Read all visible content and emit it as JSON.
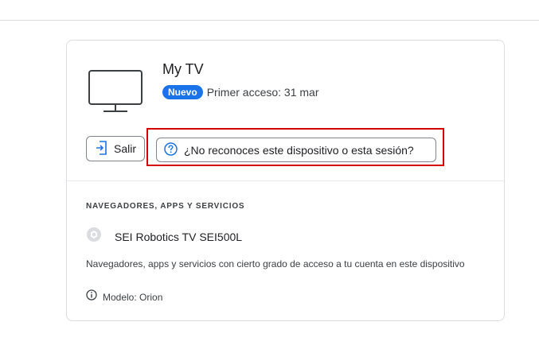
{
  "device": {
    "name": "My TV",
    "badge": "Nuevo",
    "first_access": "Primer acceso: 31 mar"
  },
  "actions": {
    "signout_label": "Salir",
    "unrecognized_label": "¿No reconoces este dispositivo o esta sesión?"
  },
  "section": {
    "title": "NAVEGADORES, APPS Y SERVICIOS",
    "browser_name": "SEI Robotics TV SEI500L",
    "description": "Navegadores, apps y servicios con cierto grado de acceso a tu cuenta en este dispositivo",
    "model": "Modelo: Orion"
  },
  "colors": {
    "accent": "#1a73e8",
    "highlight": "#d50000"
  },
  "icons": {
    "device": "tv-icon",
    "signout": "exit-icon",
    "help": "question-circle-icon",
    "browser": "generic-app-icon",
    "info": "info-icon"
  }
}
